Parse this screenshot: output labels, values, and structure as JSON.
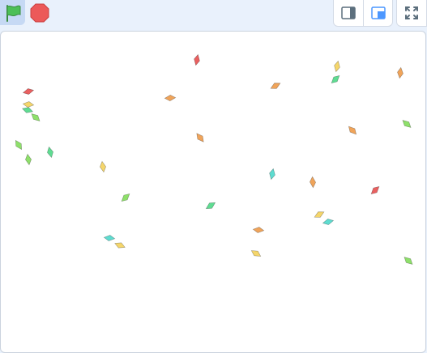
{
  "toolbar": {
    "green_flag": {
      "icon": "green-flag-icon",
      "color": "#4cbf56"
    },
    "stop": {
      "icon": "stop-sign-icon",
      "color": "#ec5959"
    },
    "layout_small": {
      "icon": "small-stage-icon"
    },
    "layout_normal": {
      "icon": "normal-stage-icon",
      "active_color": "#4c97ff"
    },
    "fullscreen": {
      "icon": "fullscreen-icon",
      "color": "#5c6f7d"
    }
  },
  "stage": {
    "background": "#ffffff",
    "confetti_colors": {
      "red": "#e96060",
      "orange": "#f0a45a",
      "yellow": "#f5d66b",
      "green": "#8ee06a",
      "mint": "#5fdc92",
      "cyan": "#5edcd0"
    }
  }
}
